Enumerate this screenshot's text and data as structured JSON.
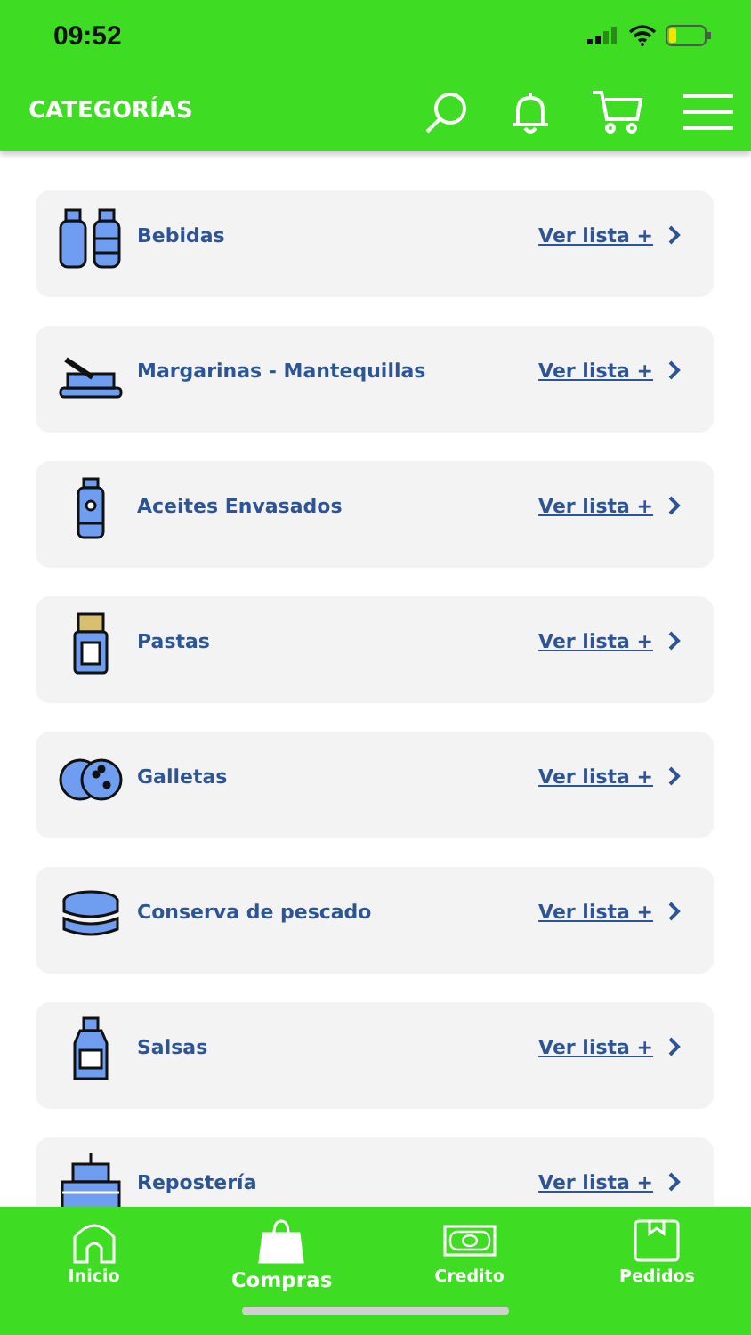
{
  "status_bar": {
    "time": "09:52"
  },
  "header": {
    "title": "CATEGORÍAS"
  },
  "categories": [
    {
      "name": "Bebidas",
      "link": "Ver lista +"
    },
    {
      "name": "Margarinas - Mantequillas",
      "link": "Ver lista +"
    },
    {
      "name": "Aceites Envasados",
      "link": "Ver lista +"
    },
    {
      "name": "Pastas",
      "link": "Ver lista +"
    },
    {
      "name": "Galletas",
      "link": "Ver lista +"
    },
    {
      "name": "Conserva de pescado",
      "link": "Ver lista +"
    },
    {
      "name": "Salsas",
      "link": "Ver lista +"
    },
    {
      "name": "Repostería",
      "link": "Ver lista +"
    }
  ],
  "tab_bar": [
    {
      "label": "Inicio",
      "selected": false
    },
    {
      "label": "Compras",
      "selected": true
    },
    {
      "label": "Credito",
      "selected": false
    },
    {
      "label": "Pedidos",
      "selected": false
    }
  ]
}
